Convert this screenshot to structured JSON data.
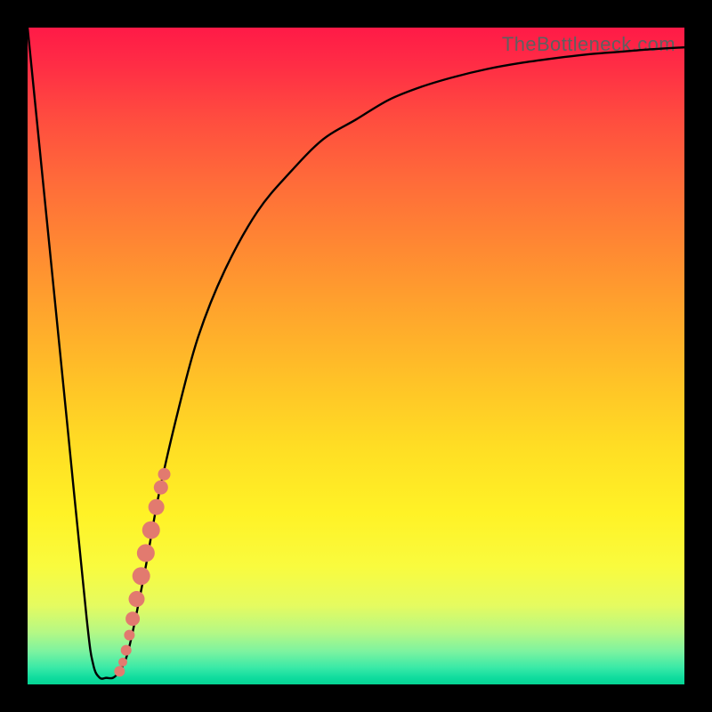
{
  "watermark": "TheBottleneck.com",
  "colors": {
    "frame": "#000000",
    "curve": "#000000",
    "dots": "#e27a6f"
  },
  "chart_data": {
    "type": "line",
    "title": "",
    "xlabel": "",
    "ylabel": "",
    "xlim": [
      0,
      100
    ],
    "ylim": [
      0,
      100
    ],
    "grid": false,
    "series": [
      {
        "name": "bottleneck-curve",
        "x": [
          0,
          3,
          6,
          9,
          10,
          11,
          12,
          13,
          14,
          15,
          16,
          18,
          20,
          23,
          26,
          30,
          35,
          40,
          45,
          50,
          55,
          60,
          65,
          70,
          75,
          80,
          85,
          90,
          95,
          100
        ],
        "y": [
          100,
          70,
          40,
          10,
          3,
          1,
          1,
          1,
          2,
          4,
          8,
          18,
          29,
          42,
          53,
          63,
          72,
          78,
          83,
          86,
          89,
          91,
          92.5,
          93.7,
          94.6,
          95.3,
          95.9,
          96.3,
          96.7,
          97
        ]
      }
    ],
    "scatter": {
      "name": "highlight-dots",
      "points": [
        {
          "x": 14.0,
          "y": 2.0,
          "r": 6
        },
        {
          "x": 14.5,
          "y": 3.4,
          "r": 5
        },
        {
          "x": 15.0,
          "y": 5.2,
          "r": 6
        },
        {
          "x": 15.5,
          "y": 7.5,
          "r": 6
        },
        {
          "x": 16.0,
          "y": 10.0,
          "r": 8
        },
        {
          "x": 16.6,
          "y": 13.0,
          "r": 9
        },
        {
          "x": 17.3,
          "y": 16.5,
          "r": 10
        },
        {
          "x": 18.0,
          "y": 20.0,
          "r": 10
        },
        {
          "x": 18.8,
          "y": 23.5,
          "r": 10
        },
        {
          "x": 19.6,
          "y": 27.0,
          "r": 9
        },
        {
          "x": 20.3,
          "y": 30.0,
          "r": 8
        },
        {
          "x": 20.8,
          "y": 32.0,
          "r": 7
        }
      ]
    }
  }
}
